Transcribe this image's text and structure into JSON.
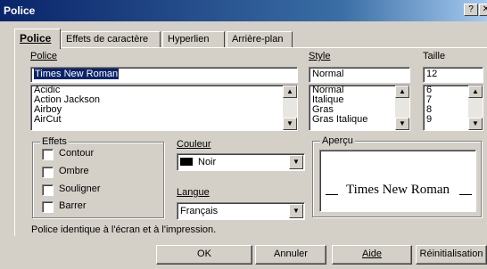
{
  "window": {
    "title": "Police"
  },
  "tabs": [
    {
      "label": "Police",
      "active": true
    },
    {
      "label": "Effets de caractère",
      "active": false
    },
    {
      "label": "Hyperlien",
      "active": false
    },
    {
      "label": "Arrière-plan",
      "active": false
    }
  ],
  "font": {
    "label": "Police",
    "value": "Times New Roman",
    "items": [
      "Acidic",
      "Action Jackson",
      "Airboy",
      "AirCut"
    ]
  },
  "style": {
    "label": "Style",
    "value": "Normal",
    "items": [
      "Normal",
      "Italique",
      "Gras",
      "Gras Italique"
    ]
  },
  "size": {
    "label": "Taille",
    "value": "12",
    "items": [
      "6",
      "7",
      "8",
      "9"
    ]
  },
  "effects": {
    "title": "Effets",
    "contour": "Contour",
    "shadow": "Ombre",
    "underline": "Souligner",
    "strikethrough": "Barrer"
  },
  "color": {
    "label": "Couleur",
    "value": "Noir",
    "swatch": "#000000"
  },
  "language": {
    "label": "Langue",
    "value": "Français"
  },
  "preview": {
    "title": "Aperçu",
    "text": "Times New Roman"
  },
  "info": "Police identique à l'écran et à l'impression.",
  "buttons": {
    "ok": "OK",
    "cancel": "Annuler",
    "help": "Aide",
    "reset": "Réinitialisation"
  }
}
